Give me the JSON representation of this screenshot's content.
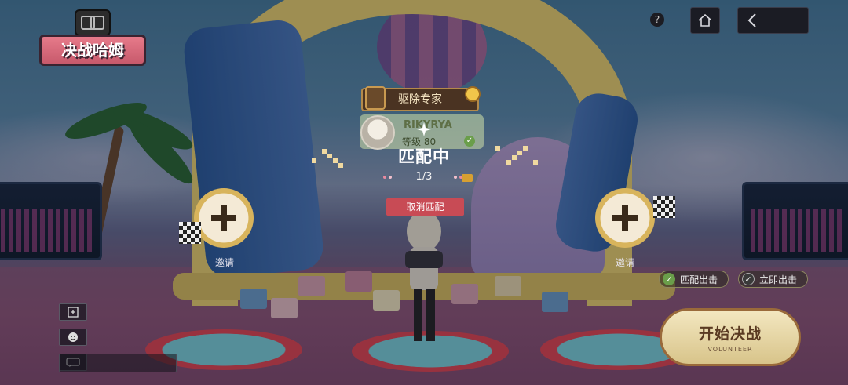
{
  "logo": {
    "text": "决战哈姆"
  },
  "top_bar": {
    "help_text": "?"
  },
  "player": {
    "title": "驱除专家",
    "name": "RIKYRYA",
    "level": "等级 80"
  },
  "matching": {
    "status": "匹配中",
    "count": "1/3",
    "cancel_label": "取消匹配"
  },
  "invite": {
    "left_label": "邀请",
    "right_label": "邀请"
  },
  "options": {
    "match_start": "匹配出击",
    "instant_start": "立即出击"
  },
  "start": {
    "label": "开始决战",
    "sub": "VOLUNTEER"
  },
  "colors": {
    "cancel": "#c84b55",
    "check_on": "#6a9e4a",
    "check_off": "#3a3a3a"
  }
}
